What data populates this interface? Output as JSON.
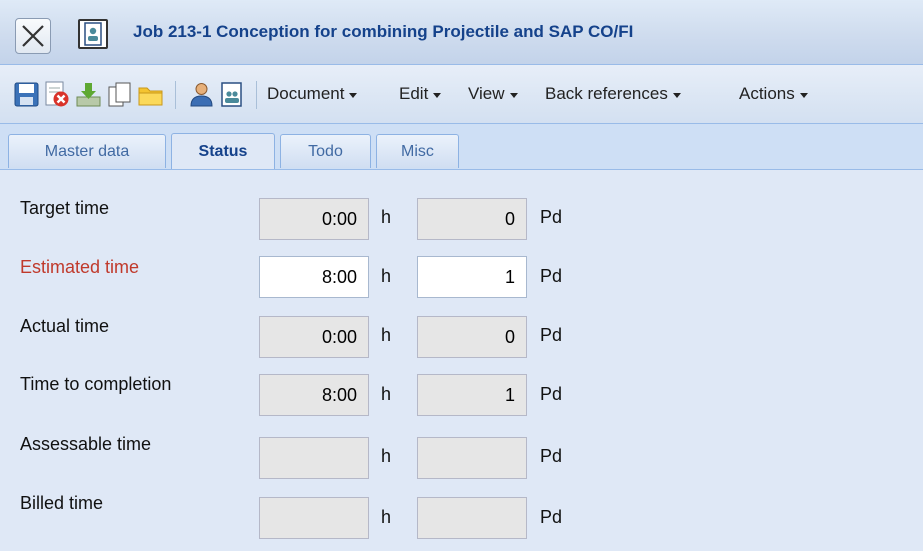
{
  "window": {
    "title": "Job 213-1 Conception for combining Projectile and SAP CO/FI",
    "close_icon": "close-icon",
    "title_icon": "contact-card-icon"
  },
  "toolbar": {
    "icons": [
      "save-icon",
      "delete-icon",
      "download-icon",
      "copy-icon",
      "folder-icon",
      "person-icon",
      "contact-card-icon"
    ],
    "menus": [
      {
        "label": "Document"
      },
      {
        "label": "Edit"
      },
      {
        "label": "View"
      },
      {
        "label": "Back references"
      },
      {
        "label": "Actions"
      }
    ]
  },
  "tabs": [
    {
      "label": "Master data",
      "active": false
    },
    {
      "label": "Status",
      "active": true
    },
    {
      "label": "Todo",
      "active": false
    },
    {
      "label": "Misc",
      "active": false
    }
  ],
  "units": {
    "hours": "h",
    "person_days": "Pd"
  },
  "rows": [
    {
      "label": "Target time",
      "hours": "0:00",
      "pd": "0",
      "editable": false,
      "highlight": false
    },
    {
      "label": "Estimated time",
      "hours": "8:00",
      "pd": "1",
      "editable": true,
      "highlight": true
    },
    {
      "label": "Actual time",
      "hours": "0:00",
      "pd": "0",
      "editable": false,
      "highlight": false
    },
    {
      "label": "Time to completion",
      "hours": "8:00",
      "pd": "1",
      "editable": false,
      "highlight": false
    },
    {
      "label": "Assessable time",
      "hours": "",
      "pd": "",
      "editable": false,
      "highlight": false
    },
    {
      "label": "Billed time",
      "hours": "",
      "pd": "",
      "editable": false,
      "highlight": false
    }
  ],
  "colors": {
    "title": "#15428b",
    "highlight_label": "#c0392b",
    "background": "#dfe8f6"
  }
}
